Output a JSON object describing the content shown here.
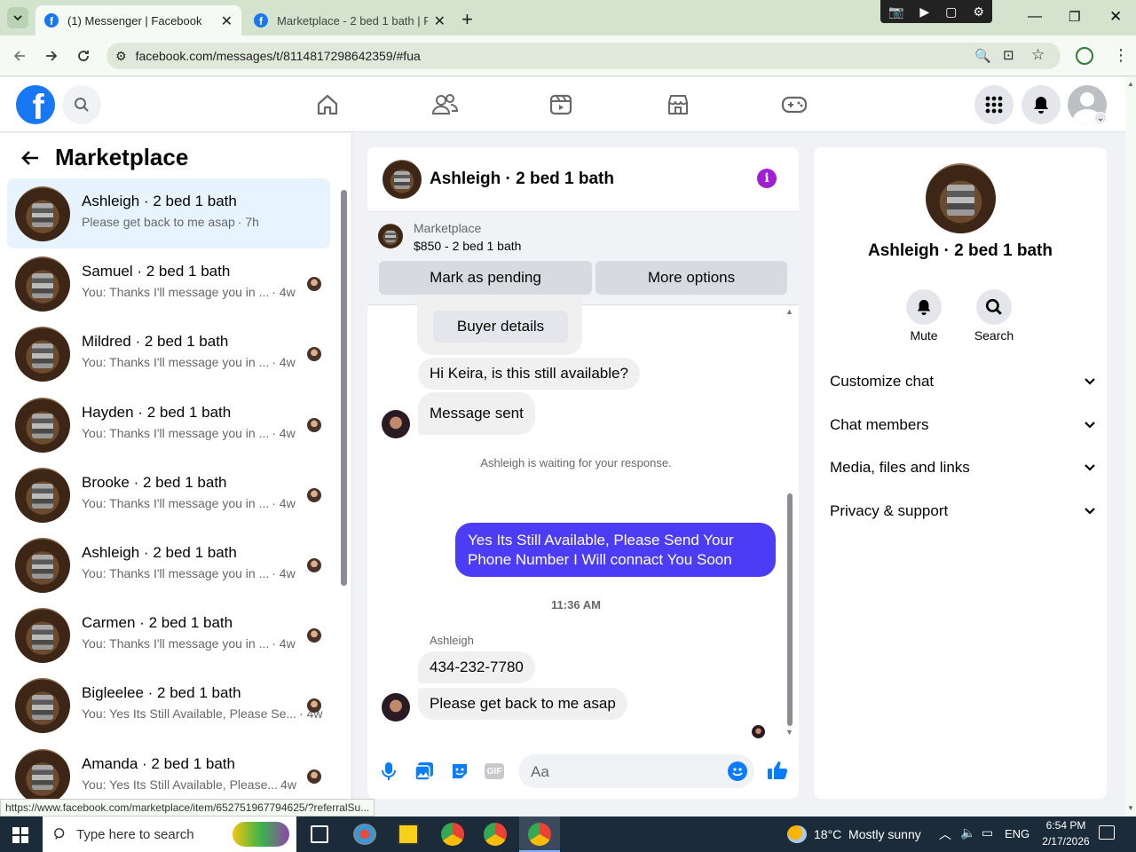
{
  "browser": {
    "tabs": [
      {
        "title": "(1) Messenger | Facebook",
        "active": true
      },
      {
        "title": "Marketplace - 2 bed 1 bath | Fa",
        "active": false
      }
    ],
    "url": "facebook.com/messages/t/8114817298642359/#fua",
    "status_url": "https://www.facebook.com/marketplace/item/652751967794625/?referralSu..."
  },
  "sidebar": {
    "title": "Marketplace",
    "conversations": [
      {
        "name": "Ashleigh · 2 bed 1 bath",
        "preview": "Please get back to me asap",
        "time": "· 7h",
        "selected": true
      },
      {
        "name": "Samuel · 2 bed 1 bath",
        "preview": "You: Thanks I'll message you in ...",
        "time": "· 4w"
      },
      {
        "name": "Mildred · 2 bed 1 bath",
        "preview": "You: Thanks I'll message you in ...",
        "time": "· 4w"
      },
      {
        "name": "Hayden · 2 bed 1 bath",
        "preview": "You: Thanks I'll message you in ...",
        "time": "· 4w"
      },
      {
        "name": "Brooke · 2 bed 1 bath",
        "preview": "You: Thanks I'll message you in ...",
        "time": "· 4w"
      },
      {
        "name": "Ashleigh · 2 bed 1 bath",
        "preview": "You: Thanks I'll message you in ...",
        "time": "· 4w"
      },
      {
        "name": "Carmen · 2 bed 1 bath",
        "preview": "You: Thanks I'll message you in ...",
        "time": "· 4w"
      },
      {
        "name": "Bigleelee · 2 bed 1 bath",
        "preview": "You: Yes Its Still Available, Please Se...",
        "time": "· 4w"
      },
      {
        "name": "Amanda · 2 bed 1 bath",
        "preview": "You: Yes Its Still Available, Please...",
        "time": "4w"
      }
    ]
  },
  "chat": {
    "header_name": "Ashleigh · 2 bed 1 bath",
    "listing_label": "Marketplace",
    "listing_detail": "$850 - 2 bed 1 bath",
    "mark_pending": "Mark as pending",
    "more_options": "More options",
    "buyer_details": "Buyer details",
    "msg_available": "Hi Keira, is this still available?",
    "msg_sent": "Message sent",
    "waiting_note": "Ashleigh is waiting for your response.",
    "my_reply": "Yes Its Still Available, Please Send Your Phone Number I Will connact You Soon",
    "timestamp": "11:36 AM",
    "sender_name": "Ashleigh",
    "msg_phone": "434-232-7780",
    "msg_asap": "Please get back to me asap",
    "composer_placeholder": "Aa"
  },
  "details": {
    "name": "Ashleigh · 2 bed 1 bath",
    "mute_label": "Mute",
    "search_label": "Search",
    "sections": [
      "Customize chat",
      "Chat members",
      "Media, files and links",
      "Privacy & support"
    ]
  },
  "taskbar": {
    "search_placeholder": "Type here to search",
    "weather": "18°C  Mostly sunny",
    "language": "ENG",
    "time": "6:54 PM",
    "date": "2/17/2026"
  },
  "colors": {
    "fb_blue": "#1877f2",
    "my_bubble": "#4c3cf5",
    "info_purple": "#a01fd6",
    "selected_row": "#e7f3ff"
  }
}
